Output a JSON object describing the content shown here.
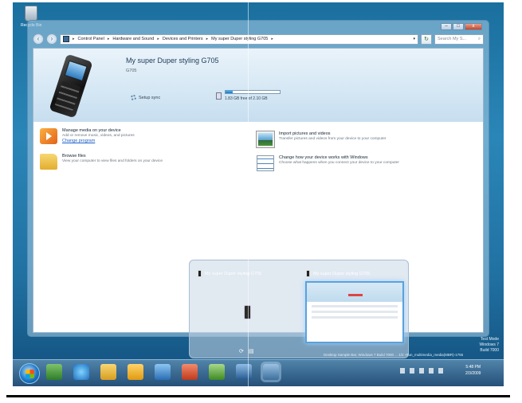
{
  "desktop": {
    "icon_label": "Recycle Bin"
  },
  "window": {
    "caption": {
      "minimize": "–",
      "maximize": "□",
      "close": "x"
    },
    "nav": {
      "back": "‹",
      "forward": "›"
    },
    "breadcrumbs": [
      "Control Panel",
      "Hardware and Sound",
      "Devices and Printers",
      "My super Duper styling G705"
    ],
    "search_placeholder": "Search My S...",
    "device": {
      "name": "My super Duper styling G705",
      "model": "G705",
      "setup_sync": "Setup sync",
      "storage_text": "1.83 GB free of 2.10 GB",
      "storage_used_fraction": 0.13
    },
    "tasks": {
      "manage_media": {
        "title": "Manage media on your device",
        "desc": "Add or remove music, videos, and pictures",
        "link": "Change program"
      },
      "browse_files": {
        "title": "Browse files",
        "desc": "View your computer to view files and folders on your device"
      },
      "import_pictures": {
        "title": "Import pictures and videos",
        "desc": "Transfer pictures and videos from your device to your computer"
      },
      "change_works": {
        "title": "Change how your device works with Windows",
        "desc": "Choose what happens when you connect your device to your computer"
      }
    }
  },
  "thumbnails": [
    {
      "title": "My super Duper styling G705"
    },
    {
      "title": "My super Duper styling G705"
    }
  ],
  "taskbar": {
    "clock_time": "5:48 PM",
    "clock_date": "2/3/2009",
    "status_line": "Desktop Sample Bar, Windows 7 Build 7000 ... 1/2 -Run_multimedia_media(MBR)-1755"
  },
  "watermark": {
    "line1": "Test Mode",
    "line2": "Windows 7",
    "line3": "Build 7000"
  }
}
